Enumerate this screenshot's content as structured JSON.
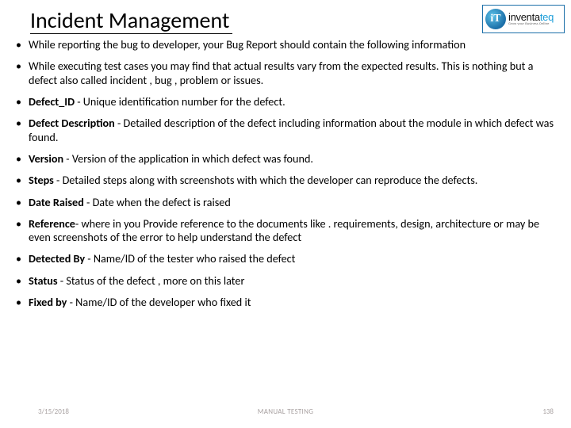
{
  "title": "Incident Management",
  "logo": {
    "mark": "iT",
    "word_pre": "inventa",
    "word_accent": "teq",
    "tagline": "Grow your Business Online"
  },
  "bullets": [
    {
      "plain": "While reporting the bug to developer, your Bug Report should contain the following information"
    },
    {
      "plain": "While executing test cases you may find that actual results vary from the expected results. This is nothing but a defect also called incident , bug , problem or issues."
    },
    {
      "label": "Defect_ID",
      "rest": " - Unique identification number for the defect."
    },
    {
      "label": "Defect Description",
      "rest": " - Detailed description of the defect including information about the module in which defect was found."
    },
    {
      "label": "Version",
      "rest": " - Version of the application in which defect was found."
    },
    {
      "label": "Steps",
      "rest": " - Detailed steps along with screenshots with which the developer can reproduce the defects."
    },
    {
      "label": "Date Raised",
      "rest": " - Date when the defect is raised"
    },
    {
      "label": "Reference",
      "rest": "-  where in you Provide reference to the documents like . requirements, design, architecture or may be even screenshots of the error  to help understand the defect"
    },
    {
      "label": "Detected By",
      "rest": " - Name/ID of the tester who raised the defect"
    },
    {
      "label": "Status",
      "rest": " - Status of the defect , more on this later"
    },
    {
      "label": "Fixed by",
      "rest": " - Name/ID of the developer who fixed it"
    }
  ],
  "footer": {
    "date": "3/15/2018",
    "center": "MANUAL TESTING",
    "page": "138"
  }
}
